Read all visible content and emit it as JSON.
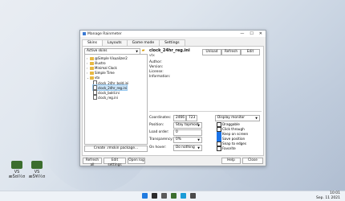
{
  "window": {
    "title": "Manage Rainmeter",
    "controls": {
      "minimize": "—",
      "maximize": "☐",
      "close": "✕"
    }
  },
  "tabs": [
    "Skins",
    "Layouts",
    "Game mode",
    "Settings"
  ],
  "left": {
    "active_skins": "Active skins",
    "tree": [
      {
        "label": "@Simple Visualizer2",
        "kind": "folder"
      },
      {
        "label": "illustro",
        "kind": "folder"
      },
      {
        "label": "Minimal Clock",
        "kind": "folder"
      },
      {
        "label": "Simple Time",
        "kind": "folder"
      },
      {
        "label": "vtx",
        "kind": "folder"
      },
      {
        "label": "clock_24hr_bold.ini",
        "kind": "file"
      },
      {
        "label": "clock_24hr_reg.ini",
        "kind": "file"
      },
      {
        "label": "clock_bold.ini",
        "kind": "file"
      },
      {
        "label": "clock_reg.ini",
        "kind": "file"
      }
    ],
    "create_package": "Create .rmskin package..."
  },
  "skin": {
    "name": "clock_24hr_reg.ini",
    "path": "vtx",
    "unload": "Unload",
    "refresh": "Refresh",
    "edit": "Edit",
    "info_labels": [
      "Author:",
      "Version:",
      "License:",
      "Information:"
    ]
  },
  "settings": {
    "coordinates_label": "Coordinates:",
    "x": "2466",
    "y": "723",
    "monitor": "Display monitor",
    "position_label": "Position:",
    "position": "Stay topmost",
    "load_order_label": "Load order:",
    "load_order": "0",
    "transparency_label": "Transparency:",
    "transparency": "0%",
    "on_hover_label": "On hover:",
    "on_hover": "Do nothing",
    "checkboxes": [
      {
        "label": "Draggable",
        "checked": false
      },
      {
        "label": "Click through",
        "checked": false
      },
      {
        "label": "Keep on screen",
        "checked": true
      },
      {
        "label": "Save position",
        "checked": true
      },
      {
        "label": "Snap to edges",
        "checked": false
      },
      {
        "label": "Favorite",
        "checked": false
      }
    ]
  },
  "bottom": {
    "refresh_all": "Refresh all",
    "edit_settings": "Edit settings",
    "open_log": "Open log",
    "help": "Help",
    "close": "Close"
  },
  "desktop": {
    "icons": [
      "VS æŠ¤ï½¤",
      "VS æŠ¥ï½¤"
    ]
  },
  "taskbar": {
    "time": "10:01",
    "date": "Sep. 11 2021"
  }
}
